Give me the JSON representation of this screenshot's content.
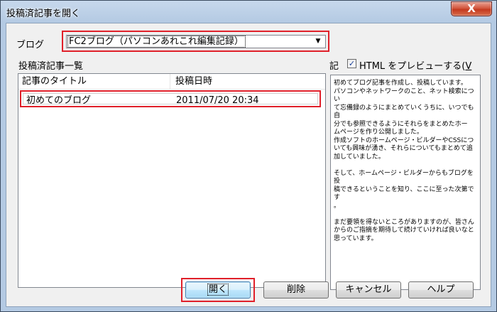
{
  "window": {
    "title": "投稿済記事を開く",
    "close_label": "X"
  },
  "blog": {
    "label": "ブログ",
    "selected": "FC2ブログ（パソコンあれこれ編集記録）",
    "arrow": "▼"
  },
  "posts": {
    "caption": "投稿済記事一覧",
    "columns": [
      "記事のタイトル",
      "投稿日時"
    ],
    "rows": [
      {
        "title": "初めてのブログ",
        "date": "2011/07/20 20:34"
      }
    ]
  },
  "preview": {
    "caption": "記",
    "checkbox_checked": true,
    "checkbox_mark": "✓",
    "checkbox_label_main": "HTML をプレビューする(",
    "checkbox_label_key": "V",
    "text": "初めてブログ記事を作成し、投稿しています。\nパソコンやネットワークのこと、ネット検索につい\nて忘備録のようにまとめていくうちに、いつでも自\n分でも参照できるようにそれらをまとめたホー\nムページを作り公開しました。\n作成ソフトのホームページ・ビルダーやCSSにつ\nいても興味が湧き、それらについてもまとめて追\n加していました。\n\nそして、ホームページ・ビルダーからもブログを投\n稿できるということを知り、ここに至った次第です\n。\n\nまだ要領を得ないところがありますのが、皆さん\nからのご指摘を期待して続けていければ良いなと\n思っています。"
  },
  "buttons": {
    "open": "開く",
    "delete": "削除",
    "cancel": "キャンセル",
    "help": "ヘルプ"
  },
  "colors": {
    "highlight": "#e0202a",
    "close_button": "#c43a1f"
  }
}
